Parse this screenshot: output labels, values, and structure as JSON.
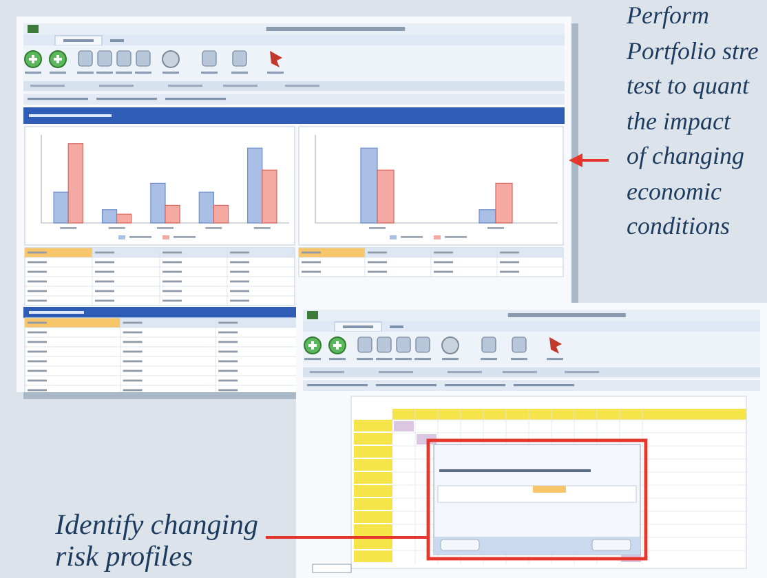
{
  "screenshots": [
    {
      "kind": "comparison"
    },
    {
      "kind": "matrix"
    }
  ],
  "callouts": [
    {
      "kind": "right",
      "lines": [
        "Perform",
        "Portfolio stre",
        "test to quant",
        "the impact",
        "of changing",
        "economic",
        "conditions"
      ]
    },
    {
      "kind": "bottom",
      "lines": [
        "Identify changing",
        "risk profiles"
      ]
    }
  ]
}
